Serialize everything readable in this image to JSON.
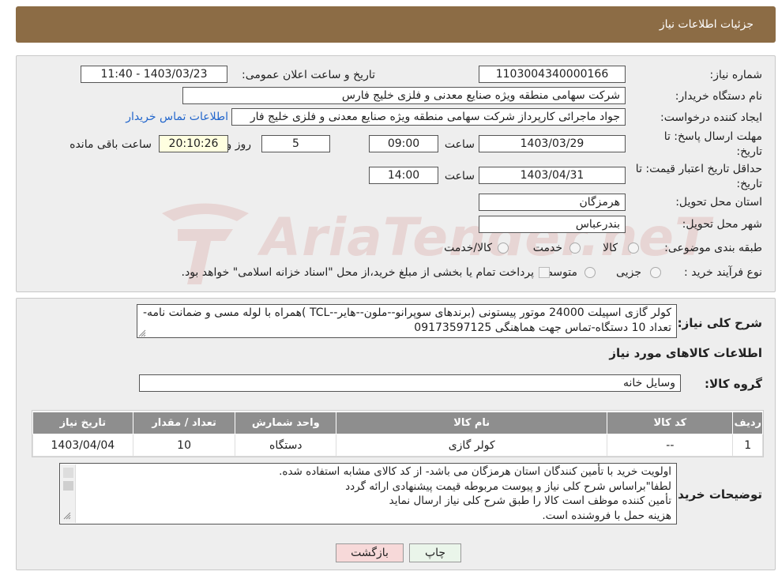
{
  "header": {
    "title": "جزئیات اطلاعات نیاز"
  },
  "form": {
    "need_number_label": "شماره نیاز:",
    "need_number": "1103004340000166",
    "announce_label": "تاریخ و ساعت اعلان عمومی:",
    "announce_value": "1403/03/23 - 11:40",
    "buyer_org_label": "نام دستگاه خریدار:",
    "buyer_org": "شرکت سهامی منطقه ویژه صنایع معدنی و فلزی خلیج فارس",
    "requester_label": "ایجاد کننده درخواست:",
    "requester": "جواد ماجرائی کارپرداز شرکت سهامی منطقه ویژه صنایع معدنی و فلزی خلیج فار",
    "contact_link": "اطلاعات تماس خریدار",
    "deadline_label": "مهلت ارسال پاسخ: تا",
    "deadline_label2": "تاریخ:",
    "deadline_date": "1403/03/29",
    "time_label": "ساعت",
    "deadline_time": "09:00",
    "days_value": "5",
    "days_label": "روز و",
    "remaining_time": "20:10:26",
    "remaining_label": "ساعت باقی مانده",
    "validity_label": "حداقل تاریخ اعتبار قیمت: تا",
    "validity_label2": "تاریخ:",
    "validity_date": "1403/04/31",
    "validity_time": "14:00",
    "province_label": "استان محل تحویل:",
    "province": "هرمزگان",
    "city_label": "شهر محل تحویل:",
    "city": "بندرعباس",
    "category_label": "طبقه بندی موضوعی:",
    "category_options": [
      "کالا",
      "خدمت",
      "کالا/خدمت"
    ],
    "process_label": "نوع فرآیند خرید :",
    "process_options": [
      "جزیی",
      "متوسط"
    ],
    "process_note": "پرداخت تمام یا بخشی از مبلغ خرید،از محل \"اسناد خزانه اسلامی\" خواهد بود."
  },
  "description": {
    "label": "شرح کلی نیاز:",
    "text": "کولر گازی اسپیلت 24000 موتور پیستونی (برندهای سوپرانو--ملون--هایر--TCL )همراه با لوله مسی و ضمانت نامه- تعداد 10 دستگاه-تماس جهت هماهنگی 09173597125",
    "goods_title": "اطلاعات کالاهای مورد نیاز",
    "group_label": "گروه کالا:",
    "group_value": "وسایل خانه"
  },
  "table": {
    "headers": [
      "ردیف",
      "کد کالا",
      "نام کالا",
      "واحد شمارش",
      "تعداد / مقدار",
      "تاریخ نیاز"
    ],
    "rows": [
      [
        "1",
        "--",
        "کولر گازی",
        "دستگاه",
        "10",
        "1403/04/04"
      ]
    ]
  },
  "buyer_notes": {
    "label": "توضیحات خریدار:",
    "lines": [
      "اولویت خرید با تأمین کنندگان استان هرمزگان می باشد- از کد کالای مشابه استفاده شده.",
      "لطفا\"براساس شرح کلی نیاز و پیوست مربوطه قیمت پیشنهادی ارائه گردد",
      "تأمین کننده موظف است کالا را طبق شرح کلی نیاز ارسال نماید",
      "هزینه حمل با فروشنده است."
    ]
  },
  "buttons": {
    "print": "چاپ",
    "back": "بازگشت"
  },
  "watermark": {
    "text": "AriaTender.neT"
  },
  "colors": {
    "header": "#8c6c45",
    "link": "#2266cc",
    "back_button": "#f7d9d9",
    "print_button": "#eaf5ea"
  }
}
